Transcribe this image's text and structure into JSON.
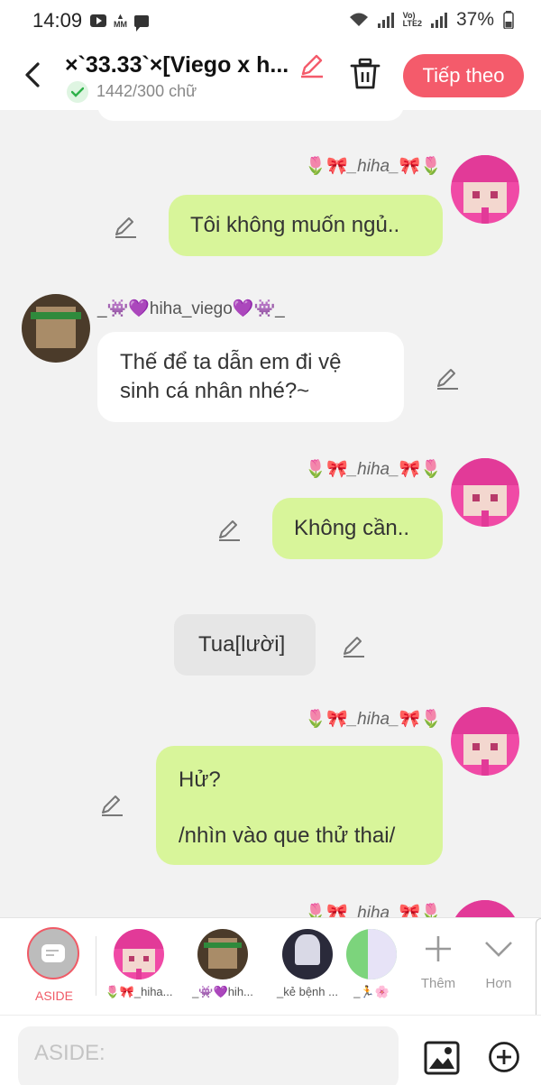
{
  "status_bar": {
    "time": "14:09",
    "battery": "37%",
    "mm_label": "M\nMM",
    "lte_label": "Vo) LTE2"
  },
  "header": {
    "title": "×`33.33`×[Viego x h...",
    "word_count": "1442/300 chữ",
    "next_label": "Tiếp theo"
  },
  "messages": [
    {
      "name_prefix": "🌷🎀",
      "name": "_hiha_",
      "name_suffix": "🎀🌷",
      "text": "Tôi không muốn ngủ.."
    },
    {
      "name_prefix": "_👾💜",
      "name": "hiha_viego",
      "name_suffix": "💜👾_",
      "text": "Thế để ta dẫn em đi vệ sinh cá nhân nhé?~"
    },
    {
      "name_prefix": "🌷🎀",
      "name": "_hiha_",
      "name_suffix": "🎀🌷",
      "text": "Không cần.."
    },
    {
      "text": "Tua[lười]"
    },
    {
      "name_prefix": "🌷🎀",
      "name": "_hiha_",
      "name_suffix": "🎀🌷",
      "text_line1": "Hử?",
      "text_line2": "/nhìn vào que thử thai/"
    },
    {
      "name_prefix": "🌷🎀",
      "name": "_hiha_",
      "name_suffix": "🎀🌷"
    }
  ],
  "character_bar": {
    "aside_label": "ASIDE",
    "characters": [
      {
        "label": "🌷🎀_hiha..."
      },
      {
        "label": "_👾💜hih..."
      },
      {
        "label": "_kẻ bệnh ..."
      },
      {
        "label": "_🏃🌸"
      }
    ],
    "add_label": "Thêm",
    "more_label": "Hơn"
  },
  "input_bar": {
    "placeholder": "ASIDE:"
  },
  "colors": {
    "accent": "#f45b6b",
    "green_bubble": "#d8f59a",
    "white_bubble": "#ffffff",
    "background": "#f2f2f2"
  }
}
